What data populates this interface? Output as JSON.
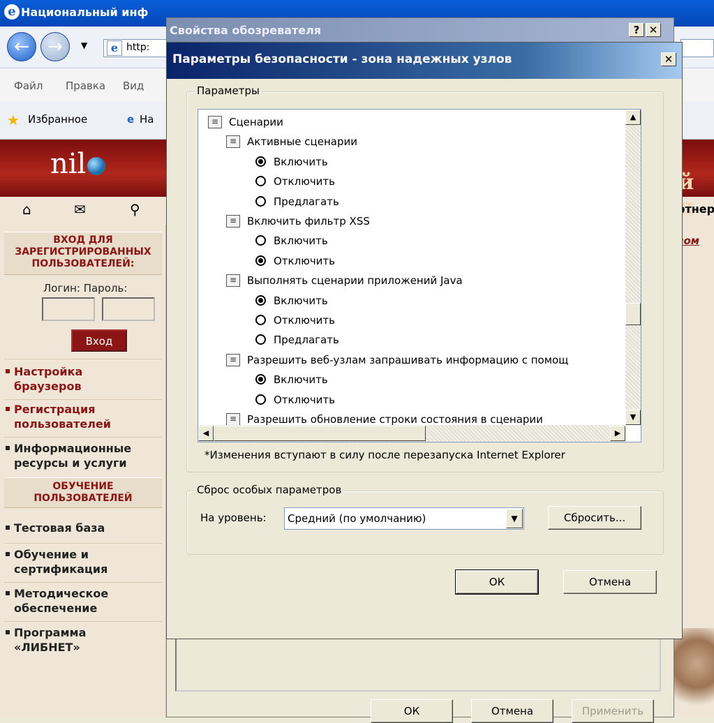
{
  "browser": {
    "title": "Национальный инф",
    "address": "http:",
    "menu": [
      "Файл",
      "Правка",
      "Вид"
    ],
    "favorites_label": "Избранное",
    "tab_label": "На"
  },
  "site": {
    "logo": "nil",
    "login_section": "ВХОД ДЛЯ ЗАРЕГИСТРИРОВАННЫХ ПОЛЬЗОВАТЕЛЕЙ:",
    "login_labels": "Логин: Пароль:",
    "enter_button": "Вход",
    "links": [
      {
        "label": "Настройка\nбраузеров"
      },
      {
        "label": "Регистрация\nпользователей"
      },
      {
        "label": "Информационные\nресурсы и услуги"
      }
    ],
    "training_section": "ОБУЧЕНИЕ\nПОЛЬЗОВАТЕЛЕЙ",
    "training_links": [
      {
        "label": "Тестовая база"
      },
      {
        "label": "Обучение и\nсертификация"
      },
      {
        "label": "Методическое\nобеспечение"
      },
      {
        "label": "Программа\n«ЛИБНЕТ»"
      }
    ],
    "right_partner": "ртнер",
    "right_link": "вом",
    "right_title": "й ц"
  },
  "options_dialog": {
    "title": "Свойства обозревателя",
    "help_btn": "?",
    "close_btn": "✕",
    "ok": "ОК",
    "cancel": "Отмена",
    "apply": "Применить"
  },
  "security_dialog": {
    "title": "Параметры безопасности - зона надежных узлов",
    "close_btn": "✕",
    "settings_group": "Параметры",
    "items": [
      {
        "kind": "group",
        "label": "Сценарии",
        "level": 0
      },
      {
        "kind": "setting",
        "label": "Активные сценарии",
        "level": 1
      },
      {
        "kind": "radio",
        "label": "Включить",
        "selected": true
      },
      {
        "kind": "radio",
        "label": "Отключить",
        "selected": false
      },
      {
        "kind": "radio",
        "label": "Предлагать",
        "selected": false
      },
      {
        "kind": "setting",
        "label": "Включить фильтр XSS",
        "level": 1
      },
      {
        "kind": "radio",
        "label": "Включить",
        "selected": false
      },
      {
        "kind": "radio",
        "label": "Отключить",
        "selected": true
      },
      {
        "kind": "setting",
        "label": "Выполнять сценарии приложений Java",
        "level": 1
      },
      {
        "kind": "radio",
        "label": "Включить",
        "selected": true
      },
      {
        "kind": "radio",
        "label": "Отключить",
        "selected": false
      },
      {
        "kind": "radio",
        "label": "Предлагать",
        "selected": false
      },
      {
        "kind": "setting",
        "label": "Разрешить веб-узлам запрашивать информацию с помощ",
        "level": 1
      },
      {
        "kind": "radio",
        "label": "Включить",
        "selected": true
      },
      {
        "kind": "radio",
        "label": "Отключить",
        "selected": false
      },
      {
        "kind": "setting",
        "label": "Разрешить обновление строки состояния в сценарии",
        "level": 1
      }
    ],
    "note": "*Изменения вступают в силу после перезапуска Internet Explorer",
    "reset_group": "Сброс особых параметров",
    "reset_label": "На уровень:",
    "reset_level": "Средний (по умолчанию)",
    "reset_button": "Сбросить...",
    "ok": "ОК",
    "cancel": "Отмена"
  },
  "colors": {
    "titlebar_active": "#0a246a",
    "titlebar_inactive": "#7b8fb1",
    "dialog_bg": "#ece9d8",
    "site_accent": "#8b1414"
  },
  "icons": {
    "radio_selected": "radio-checked-icon",
    "script_setting": "script-setting-icon"
  }
}
